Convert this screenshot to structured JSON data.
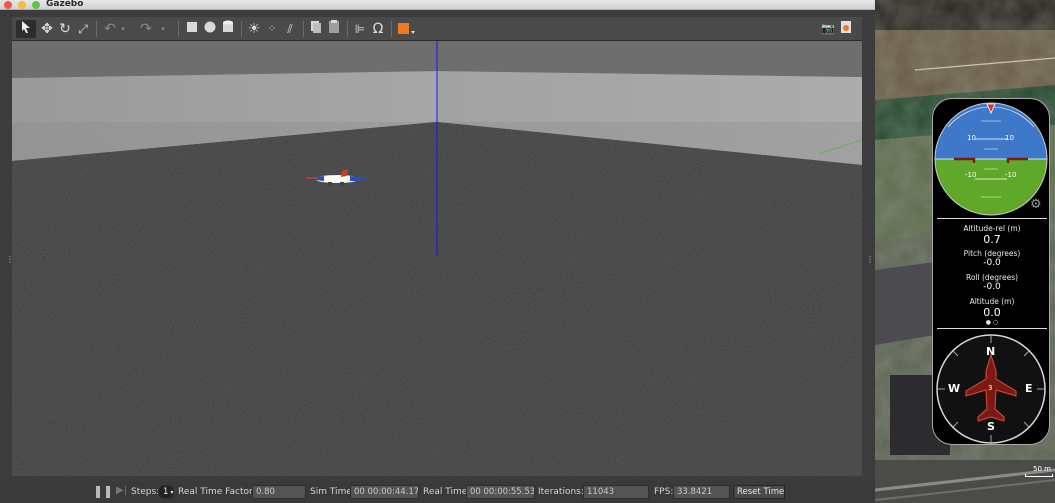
{
  "window": {
    "title": "Gazebo"
  },
  "toolbar": {
    "icons": [
      "select-arrow-icon",
      "translate-icon",
      "rotate-icon",
      "scale-icon",
      "undo-icon",
      "undo-dropdown-icon",
      "redo-icon",
      "redo-dropdown-icon",
      "box-icon",
      "sphere-icon",
      "cylinder-icon",
      "point-light-icon",
      "spot-light-icon",
      "directional-light-icon",
      "copy-icon",
      "paste-icon",
      "align-icon",
      "snap-icon",
      "view-angle-icon",
      "screenshot-icon",
      "record-icon"
    ]
  },
  "bottom_bar": {
    "steps_label": "Steps:",
    "steps_value": "1",
    "real_time_factor_label": "Real Time Factor:",
    "real_time_factor_value": "0.80",
    "sim_time_label": "Sim Time:",
    "sim_time_value": "00 00:00:44.172",
    "real_time_label": "Real Time:",
    "real_time_value": "00 00:00:55.533",
    "iterations_label": "Iterations:",
    "iterations_value": "11043",
    "fps_label": "FPS:",
    "fps_value": "33.8421",
    "reset_label": "Reset Time"
  },
  "instruments": {
    "pitch_ticks": [
      "10",
      "10",
      "-10",
      "-10"
    ],
    "altitude_rel_label": "Altitude-rel (m)",
    "altitude_rel_value": "0.7",
    "pitch_label": "Pitch (degrees)",
    "pitch_value": "-0.0",
    "roll_label": "Roll (degrees)",
    "roll_value": "-0.0",
    "altitude_label": "Altitude (m)",
    "altitude_value": "0.0",
    "compass": {
      "n": "N",
      "e": "E",
      "s": "S",
      "w": "W",
      "heading": "3"
    }
  },
  "map": {
    "scale_label": "50 m"
  },
  "colors": {
    "attitude_sky": "#3f78c8",
    "attitude_ground": "#5fa82a",
    "record_icon": "#f07820",
    "aircraft": "#d23a2a",
    "axis_z": "#1515ff"
  }
}
